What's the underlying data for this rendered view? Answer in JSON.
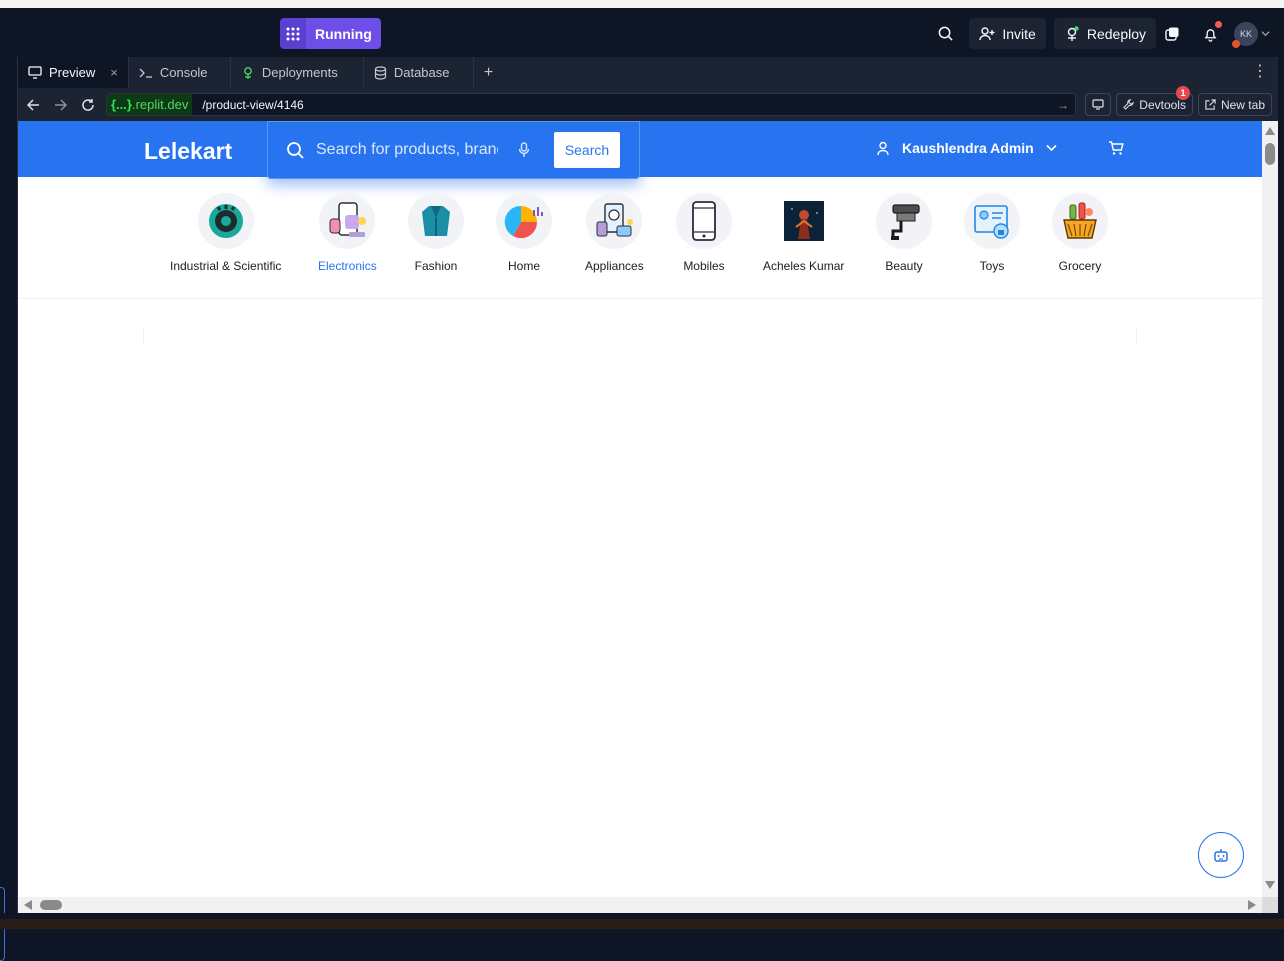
{
  "ide": {
    "run_label": "Running",
    "invite_label": "Invite",
    "redeploy_label": "Redeploy",
    "avatar_initials": "KK",
    "tabs": [
      {
        "label": "Preview",
        "close": "×"
      },
      {
        "label": "Console"
      },
      {
        "label": "Deployments"
      },
      {
        "label": "Database"
      }
    ],
    "add_tab": "+",
    "url_host_prefix": "{...}",
    "url_host": ".replit.dev",
    "url_path": "/product-view/4146",
    "devtools_label": "Devtools",
    "devtools_badge": "1",
    "newtab_label": "New tab"
  },
  "site": {
    "logo": "Lelekart",
    "search_placeholder": "Search for products, brands and more",
    "search_button": "Search",
    "user_name": "Kaushlendra Admin",
    "categories": [
      {
        "label": "Industrial & Scientific"
      },
      {
        "label": "Electronics",
        "selected": true
      },
      {
        "label": "Fashion"
      },
      {
        "label": "Home"
      },
      {
        "label": "Appliances"
      },
      {
        "label": "Mobiles"
      },
      {
        "label": "Acheles Kumar"
      },
      {
        "label": "Beauty"
      },
      {
        "label": "Toys"
      },
      {
        "label": "Grocery"
      }
    ]
  },
  "colors": {
    "brand": "#2874f0",
    "ide_bg": "#0e1525",
    "run_accent": "#6d4fe8"
  }
}
